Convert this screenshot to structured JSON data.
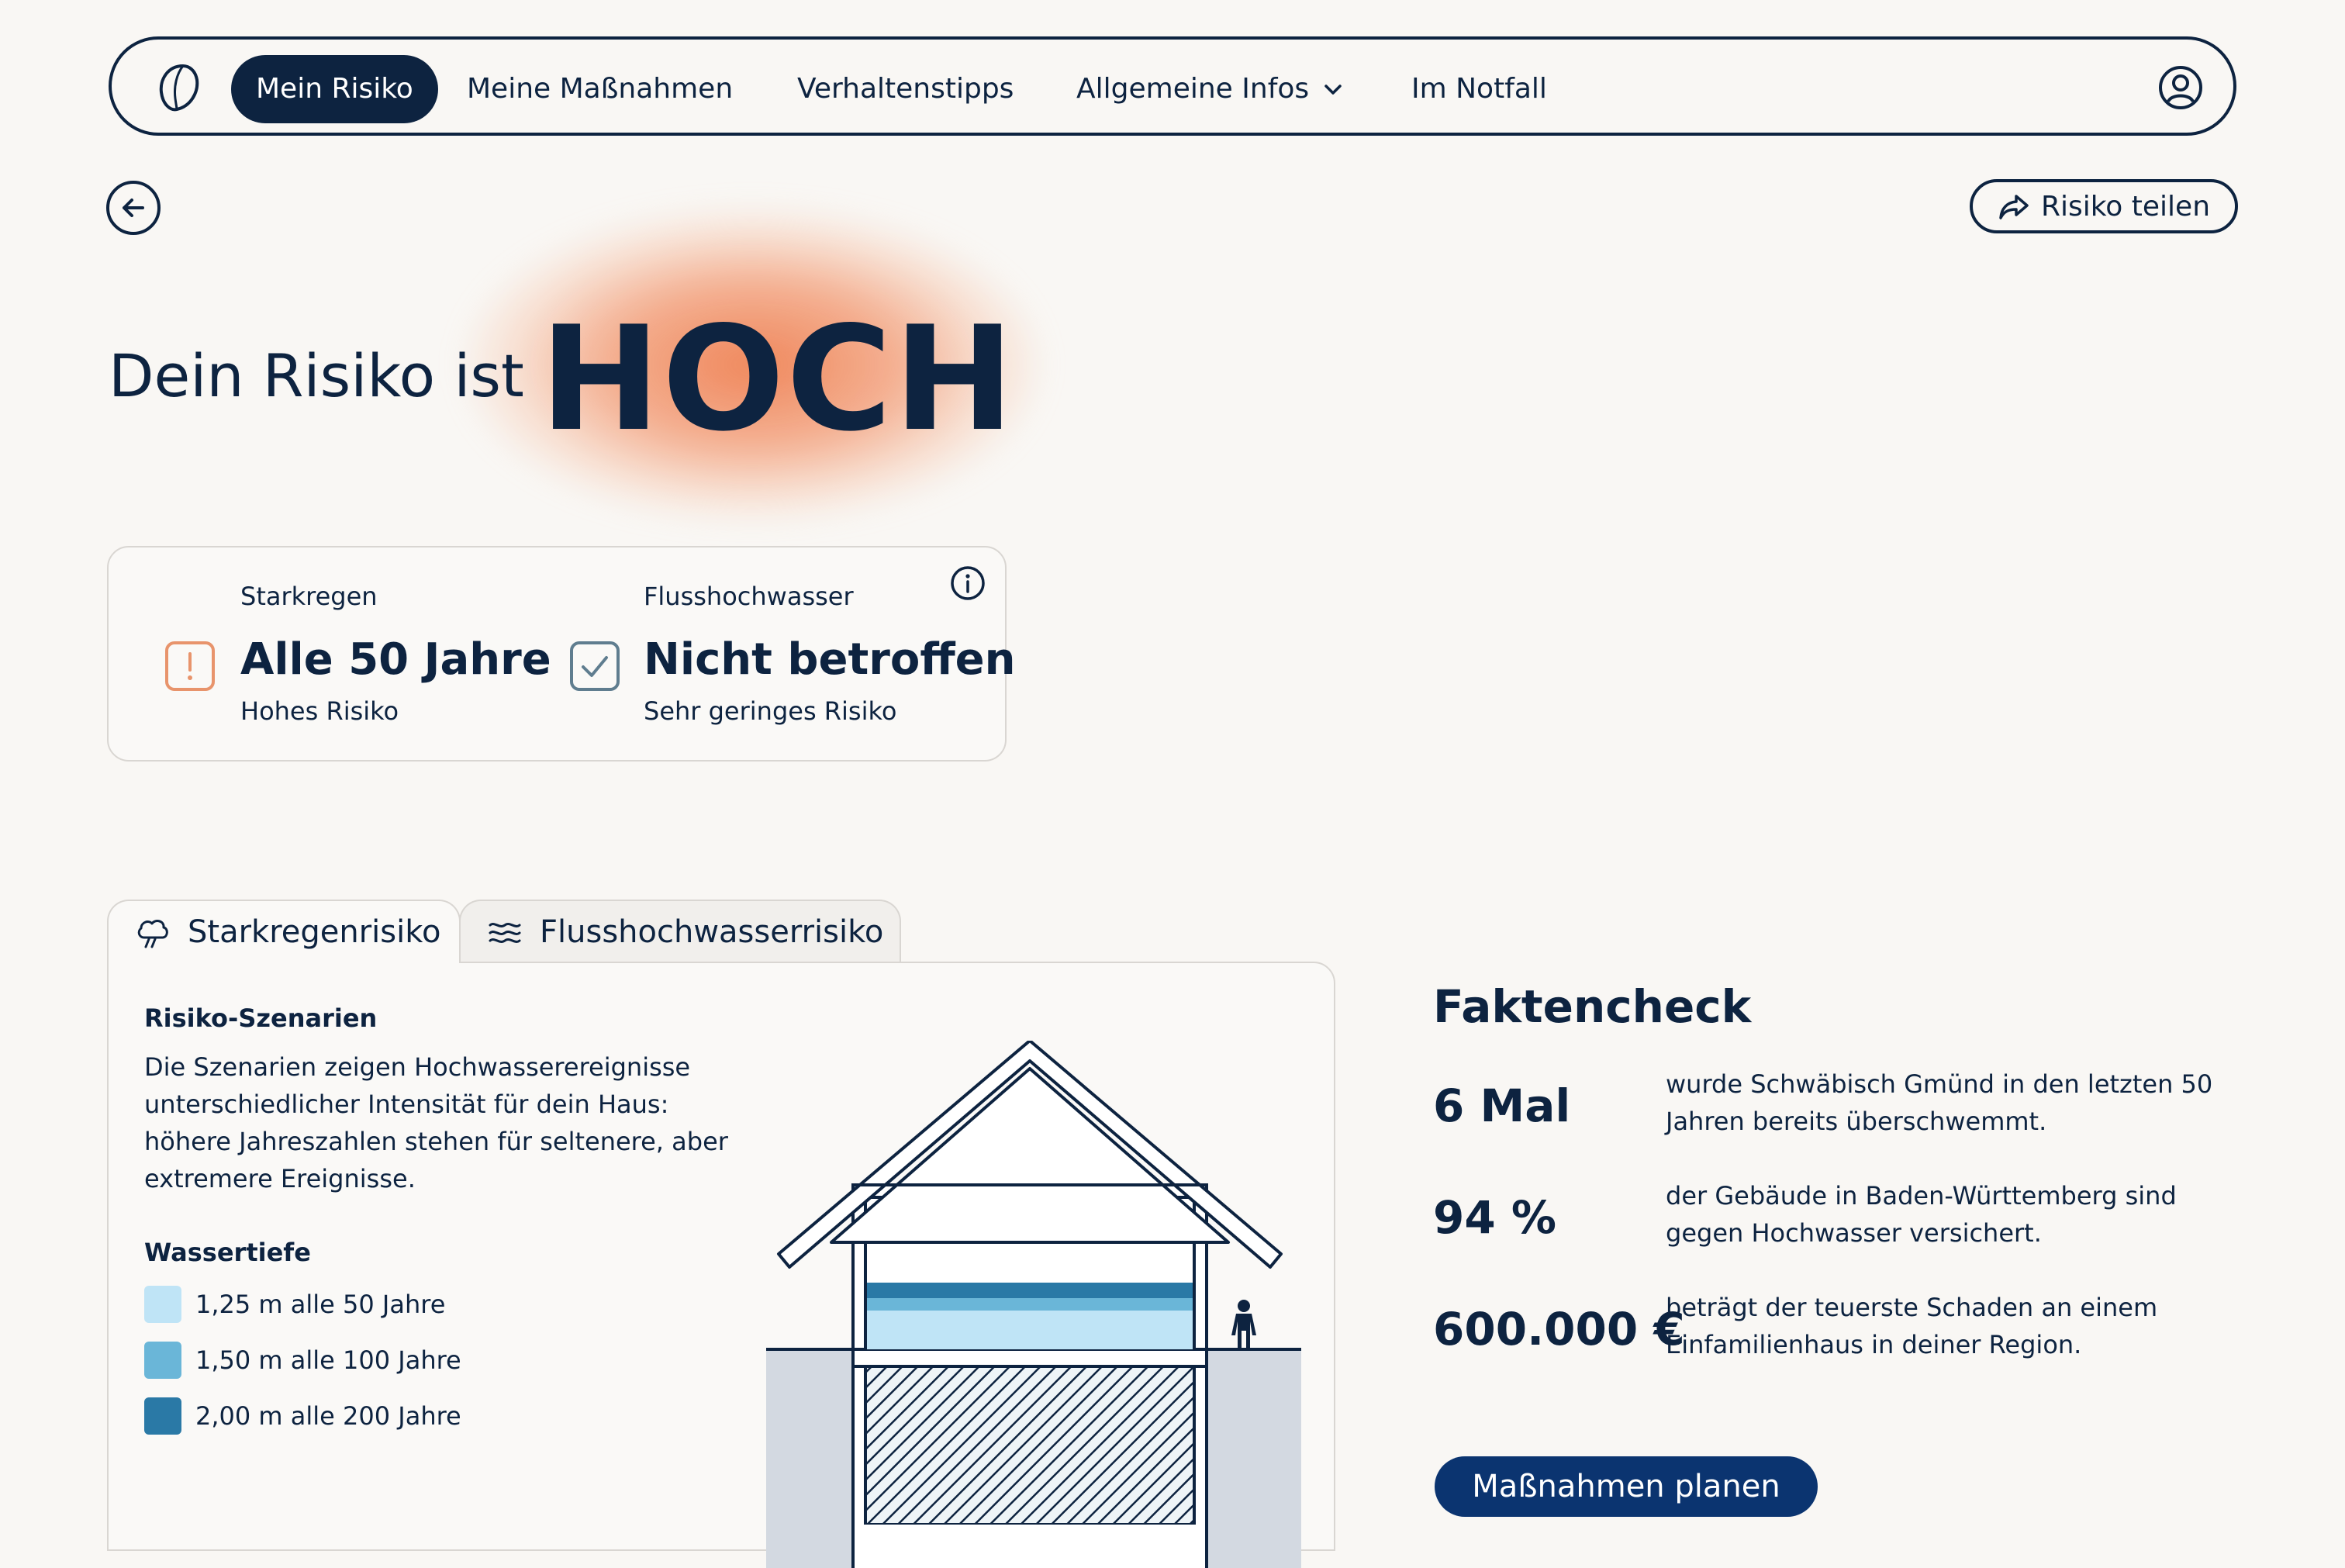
{
  "nav": {
    "items": [
      {
        "label": "Mein Risiko",
        "active": true
      },
      {
        "label": "Meine Maßnahmen"
      },
      {
        "label": "Verhaltenstipps"
      },
      {
        "label": "Allgemeine Infos",
        "has_dropdown": true
      },
      {
        "label": "Im Notfall"
      }
    ],
    "icons": {
      "logo": "logo-icon",
      "user": "user-icon"
    }
  },
  "actions": {
    "share_label": "Risiko teilen",
    "icons": {
      "back": "arrow-left-icon",
      "share": "share-icon"
    }
  },
  "hero": {
    "prefix": "Dein Risiko ist",
    "level": "HOCH",
    "glow_color": "#ee8052"
  },
  "risk_summary": {
    "items": [
      {
        "label": "Starkregen",
        "value": "Alle 50 Jahre",
        "sub": "Hohes Risiko",
        "icon": "warning-icon",
        "icon_color": "#e8946c"
      },
      {
        "label": "Flusshochwasser",
        "value": "Nicht betroffen",
        "sub": "Sehr geringes Risiko",
        "icon": "check-icon",
        "icon_color": "#5f7d8f"
      }
    ],
    "info_icon": "info-icon"
  },
  "tabs": [
    {
      "label": "Starkregenrisiko",
      "icon": "rain-cloud-icon",
      "active": true
    },
    {
      "label": "Flusshochwasserrisiko",
      "icon": "waves-icon",
      "active": false
    }
  ],
  "scenarios": {
    "title": "Risiko-Szenarien",
    "description": "Die Szenarien zeigen Hochwasserereignisse unterschiedlicher Intensität für dein Haus: höhere Jahreszahlen stehen für seltenere, aber extremere Ereignisse.",
    "depth_title": "Wassertiefe",
    "legend": [
      {
        "label": "1,25 m alle 50 Jahre",
        "color": "#bfe4f6"
      },
      {
        "label": "1,50 m alle 100 Jahre",
        "color": "#6ab6d8"
      },
      {
        "label": "2,00 m alle 200 Jahre",
        "color": "#2a79a6"
      }
    ],
    "illustration": "house-flood-illustration"
  },
  "factcheck": {
    "title": "Faktencheck",
    "items": [
      {
        "value": "6 Mal",
        "text": "wurde Schwäbisch Gmünd in den letzten 50 Jahren bereits überschwemmt."
      },
      {
        "value": "94 %",
        "text": "der Gebäude in Baden-Württemberg sind gegen Hochwasser versichert."
      },
      {
        "value": "600.000 €",
        "text": "beträgt der teuerste Schaden an einem Einfamilienhaus in deiner Region."
      }
    ],
    "cta": "Maßnahmen planen"
  },
  "colors": {
    "navy": "#0d2340",
    "accent": "#ee8052",
    "cta": "#0b3470",
    "background": "#f9f7f4"
  }
}
